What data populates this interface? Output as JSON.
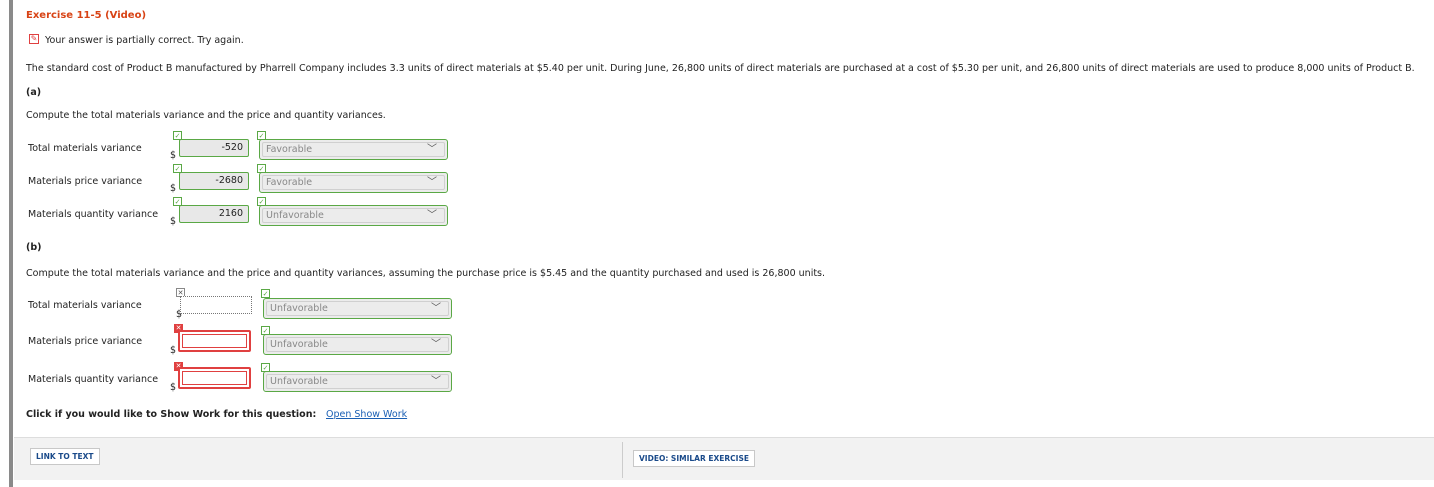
{
  "exercise_title": "Exercise 11-5 (Video)",
  "status_message": "Your answer is partially correct.  Try again.",
  "problem_text": "The standard cost of Product B manufactured by Pharrell Company includes 3.3 units of direct materials at $5.40 per unit. During June, 26,800 units of direct materials are purchased at a cost of $5.30 per unit, and 26,800 units of direct materials are used to produce 8,000 units of Product B.",
  "part_a": {
    "heading": "(a)",
    "instruction": "Compute the total materials variance and the price and quantity variances.",
    "rows": [
      {
        "label": "Total materials variance",
        "currency": "$",
        "value": "-520",
        "selection": "Favorable"
      },
      {
        "label": "Materials price variance",
        "currency": "$",
        "value": "-2680",
        "selection": "Favorable"
      },
      {
        "label": "Materials quantity variance",
        "currency": "$",
        "value": "2160",
        "selection": "Unfavorable"
      }
    ]
  },
  "part_b": {
    "heading": "(b)",
    "instruction": "Compute the total materials variance and the price and quantity variances, assuming the purchase price is $5.45 and the quantity purchased and used is 26,800 units.",
    "rows": [
      {
        "label": "Total materials variance",
        "currency": "$",
        "value": "",
        "selection": "Unfavorable"
      },
      {
        "label": "Materials price variance",
        "currency": "$",
        "value": "",
        "selection": "Unfavorable"
      },
      {
        "label": "Materials quantity variance",
        "currency": "$",
        "value": "",
        "selection": "Unfavorable"
      }
    ]
  },
  "show_work": {
    "prompt": "Click if you would like to Show Work for this question:",
    "link": "Open Show Work"
  },
  "footer": {
    "link_to_text": "LINK TO TEXT",
    "video_similar": "VIDEO: SIMILAR EXERCISE"
  },
  "colors": {
    "title": "#d84315",
    "correct": "#5aa845",
    "incorrect": "#e04040",
    "link": "#1a5fb4"
  }
}
